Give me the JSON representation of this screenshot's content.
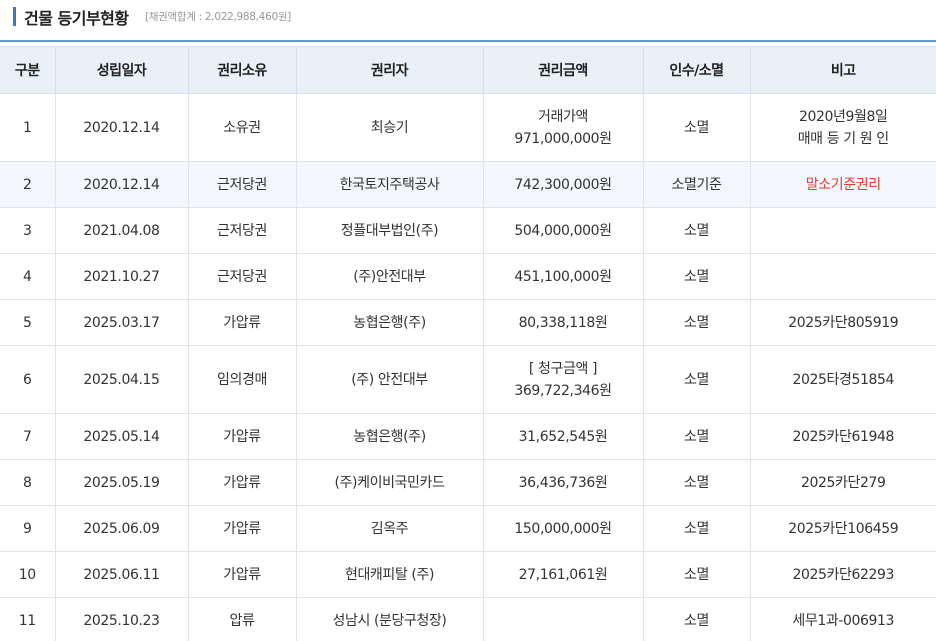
{
  "section": {
    "title": "건물 등기부현황",
    "subtitle": "[채권액합계 : 2,022,988,460원]"
  },
  "columns": [
    "구분",
    "성립일자",
    "권리소유",
    "권리자",
    "권리금액",
    "인수/소멸",
    "비고"
  ],
  "rows": [
    {
      "no": "1",
      "date": "2020.12.14",
      "type": "소유권",
      "holder": "최승기",
      "amount_line1": "거래가액",
      "amount_line2": "971,000,000원",
      "status": "소멸",
      "note_line1": "2020년9월8일",
      "note_line2": "매매 등 기 원 인"
    },
    {
      "no": "2",
      "date": "2020.12.14",
      "type": "근저당권",
      "holder": "한국토지주택공사",
      "amount": "742,300,000원",
      "status": "소멸기준",
      "note": "말소기준권리"
    },
    {
      "no": "3",
      "date": "2021.04.08",
      "type": "근저당권",
      "holder": "정플대부법인(주)",
      "amount": "504,000,000원",
      "status": "소멸",
      "note": ""
    },
    {
      "no": "4",
      "date": "2021.10.27",
      "type": "근저당권",
      "holder": "(주)안전대부",
      "amount": "451,100,000원",
      "status": "소멸",
      "note": ""
    },
    {
      "no": "5",
      "date": "2025.03.17",
      "type": "가압류",
      "holder": "농협은행(주)",
      "amount": "80,338,118원",
      "status": "소멸",
      "note": "2025카단805919"
    },
    {
      "no": "6",
      "date": "2025.04.15",
      "type": "임의경매",
      "holder": "(주) 안전대부",
      "amount_line1": "[ 청구금액 ]",
      "amount_line2": "369,722,346원",
      "status": "소멸",
      "note": "2025타경51854"
    },
    {
      "no": "7",
      "date": "2025.05.14",
      "type": "가압류",
      "holder": "농협은행(주)",
      "amount": "31,652,545원",
      "status": "소멸",
      "note": "2025카단61948"
    },
    {
      "no": "8",
      "date": "2025.05.19",
      "type": "가압류",
      "holder": "(주)케이비국민카드",
      "amount": "36,436,736원",
      "status": "소멸",
      "note": "2025카단279"
    },
    {
      "no": "9",
      "date": "2025.06.09",
      "type": "가압류",
      "holder": "김옥주",
      "amount": "150,000,000원",
      "status": "소멸",
      "note": "2025카단106459"
    },
    {
      "no": "10",
      "date": "2025.06.11",
      "type": "가압류",
      "holder": "현대캐피탈 (주)",
      "amount": "27,161,061원",
      "status": "소멸",
      "note": "2025카단62293"
    },
    {
      "no": "11",
      "date": "2025.10.23",
      "type": "압류",
      "holder": "성남시 (분당구청장)",
      "amount": "",
      "status": "소멸",
      "note": "세무1과-006913"
    }
  ],
  "colors": {
    "accent": "#3a78c2",
    "header_bg": "#e9f0f8",
    "alt_row_bg": "#f3f7fb",
    "highlight_text": "#e03c31"
  }
}
